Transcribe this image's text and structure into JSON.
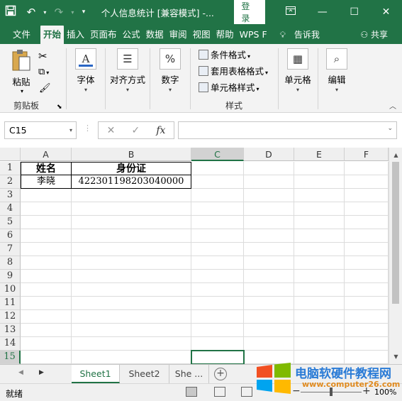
{
  "titlebar": {
    "title": "个人信息统计  [兼容模式]  -...",
    "login": "登录",
    "save_icon": "save-icon",
    "undo_icon": "undo-icon",
    "redo_icon": "redo-icon"
  },
  "tabs": [
    {
      "label": "文件"
    },
    {
      "label": "开始"
    },
    {
      "label": "插入"
    },
    {
      "label": "页面布"
    },
    {
      "label": "公式"
    },
    {
      "label": "数据"
    },
    {
      "label": "审阅"
    },
    {
      "label": "视图"
    },
    {
      "label": "帮助"
    },
    {
      "label": "WPS F"
    }
  ],
  "tellme": "告诉我",
  "share": "共享",
  "ribbon": {
    "clipboard": {
      "paste": "粘贴",
      "label": "剪贴板"
    },
    "font": {
      "label": "字体"
    },
    "alignment": {
      "label": "对齐方式"
    },
    "number": {
      "label": "数字"
    },
    "styles": {
      "conditional": "条件格式",
      "table_format": "套用表格格式",
      "cell_styles": "单元格样式",
      "label": "样式"
    },
    "cells": {
      "label": "单元格"
    },
    "editing": {
      "label": "编辑"
    }
  },
  "formula_bar": {
    "name_box": "C15",
    "fx": "fx",
    "formula": ""
  },
  "grid": {
    "columns": [
      "A",
      "B",
      "C",
      "D",
      "E",
      "F"
    ],
    "rows": [
      "1",
      "2",
      "3",
      "4",
      "5",
      "6",
      "7",
      "8",
      "9",
      "10",
      "11",
      "12",
      "13",
      "14",
      "15"
    ],
    "cells": {
      "A1": "姓名",
      "B1": "身份证",
      "A2": "李晓",
      "B2": "422301198203040000"
    }
  },
  "sheets": [
    "Sheet1",
    "Sheet2",
    "She ..."
  ],
  "status": {
    "text": "就绪",
    "zoom": "100%",
    "zoom_fraction": 0.5
  },
  "watermark": {
    "title": "电脑软硬件教程网",
    "url": "www.computer26.com"
  },
  "colors": {
    "accent": "#217346",
    "watermark_blue": "#2a7bd6",
    "watermark_orange": "#e08a1e"
  }
}
